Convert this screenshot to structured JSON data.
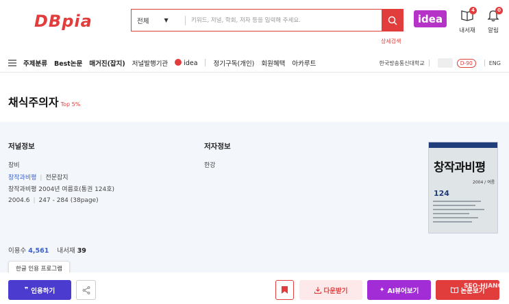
{
  "header": {
    "logo": "DBpia",
    "search": {
      "scope": "전체",
      "placeholder": "키워드, 저널, 학회, 저자 등을 입력해 주세요.",
      "advanced_label": "상세검색"
    },
    "idea_label": "idea",
    "library": {
      "label": "내서재",
      "count": "4"
    },
    "alerts": {
      "label": "알림",
      "count": "0"
    }
  },
  "nav": {
    "items": [
      "주제분류",
      "Best논문",
      "매거진(잡지)",
      "저널발행기관",
      "idea",
      "정기구독(개인)",
      "회원혜택",
      "아카루트"
    ],
    "institution": "한국방송통신대학교",
    "dday": "D-90",
    "lang": "ENG"
  },
  "article": {
    "title": "채식주의자",
    "top_tag": "Top 5%"
  },
  "journal_info": {
    "heading": "저널정보",
    "publisher": "창비",
    "journal": "창작과비평",
    "journal_type": "전문잡지",
    "issue": "창작과비평 2004년 여름호(통권 124호)",
    "date": "2004.6",
    "pages": "247 - 284 (38page)"
  },
  "author_info": {
    "heading": "저자정보",
    "author": "한강"
  },
  "cover": {
    "title": "창작과비평",
    "subtitle": "2004 / 여름",
    "number": "124"
  },
  "stats": {
    "usage_label": "이용수",
    "usage_value": "4,561",
    "library_label": "내서재",
    "library_value": "39"
  },
  "tooltip": "한글 인용 프로그램",
  "actions": {
    "cite": "인용하기",
    "download": "다운받기",
    "ai_viewer": "AI뷰어보기",
    "view": "논문보기"
  },
  "watermark": "SEO-HJANG",
  "colors": {
    "brand_red": "#e23d3d",
    "cite_purple": "#4b3ccf",
    "ai_purple": "#a22dd6",
    "idea_purple": "#b533c6",
    "link_blue": "#3a5fcd"
  }
}
